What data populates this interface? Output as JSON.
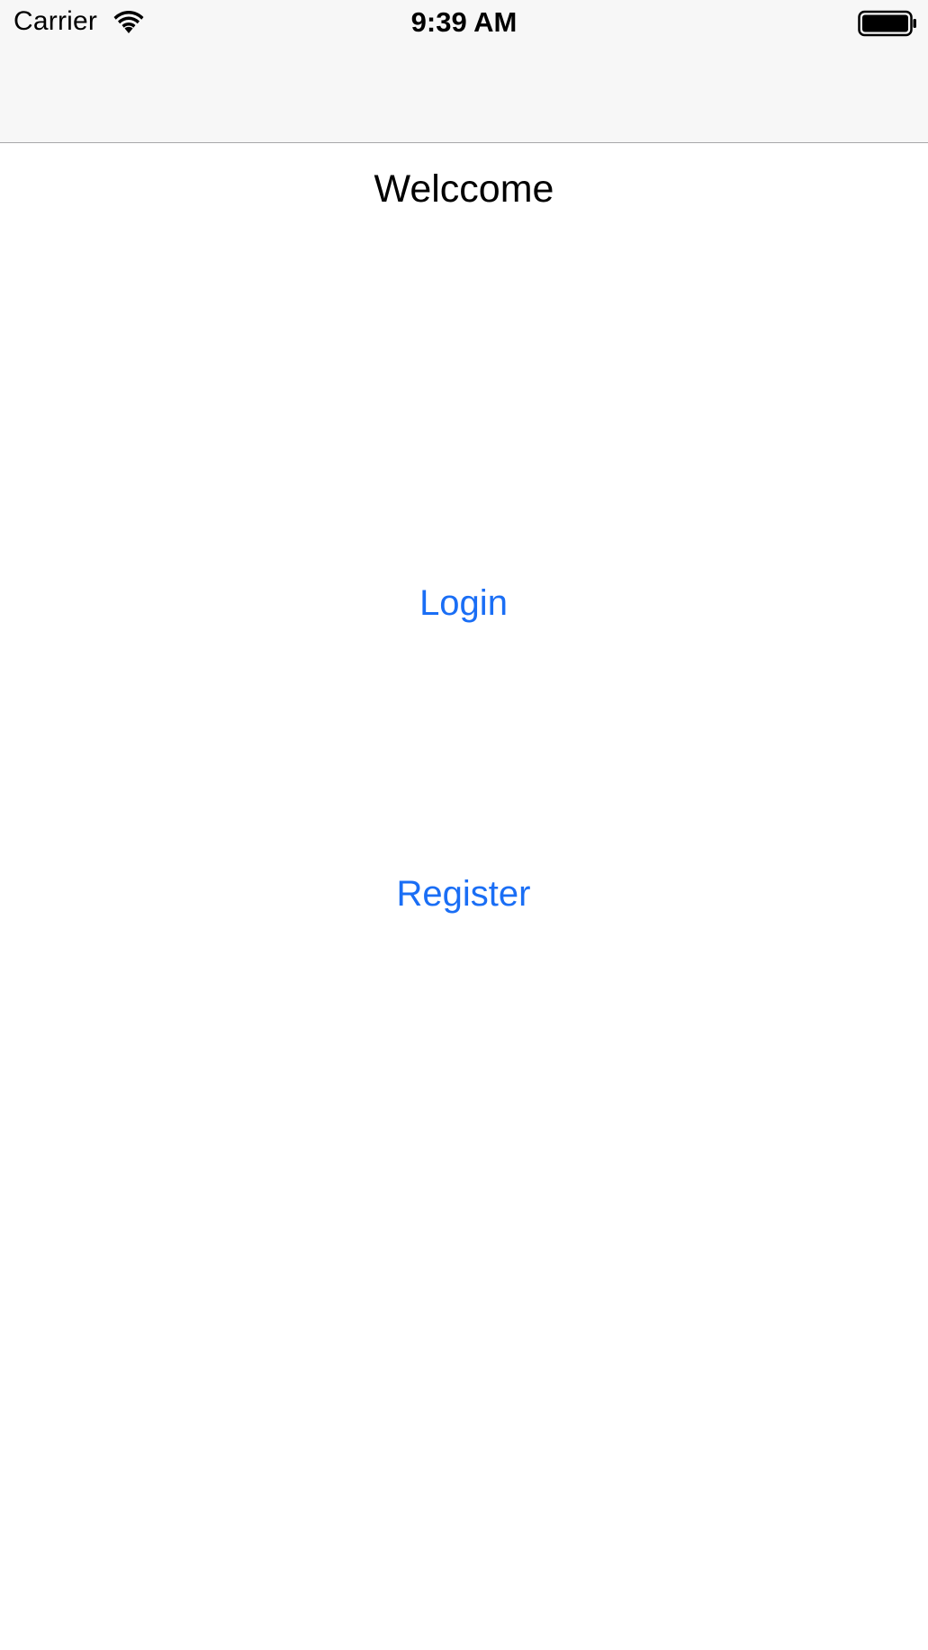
{
  "status_bar": {
    "carrier": "Carrier",
    "time": "9:39 AM",
    "wifi_icon": "wifi-icon",
    "battery_icon": "battery-icon"
  },
  "main": {
    "title": "Welccome",
    "login_label": "Login",
    "register_label": "Register"
  },
  "colors": {
    "accent": "#1a6ef5",
    "nav_background": "#f7f7f7",
    "background": "#ffffff",
    "separator": "#a7a7aa"
  }
}
